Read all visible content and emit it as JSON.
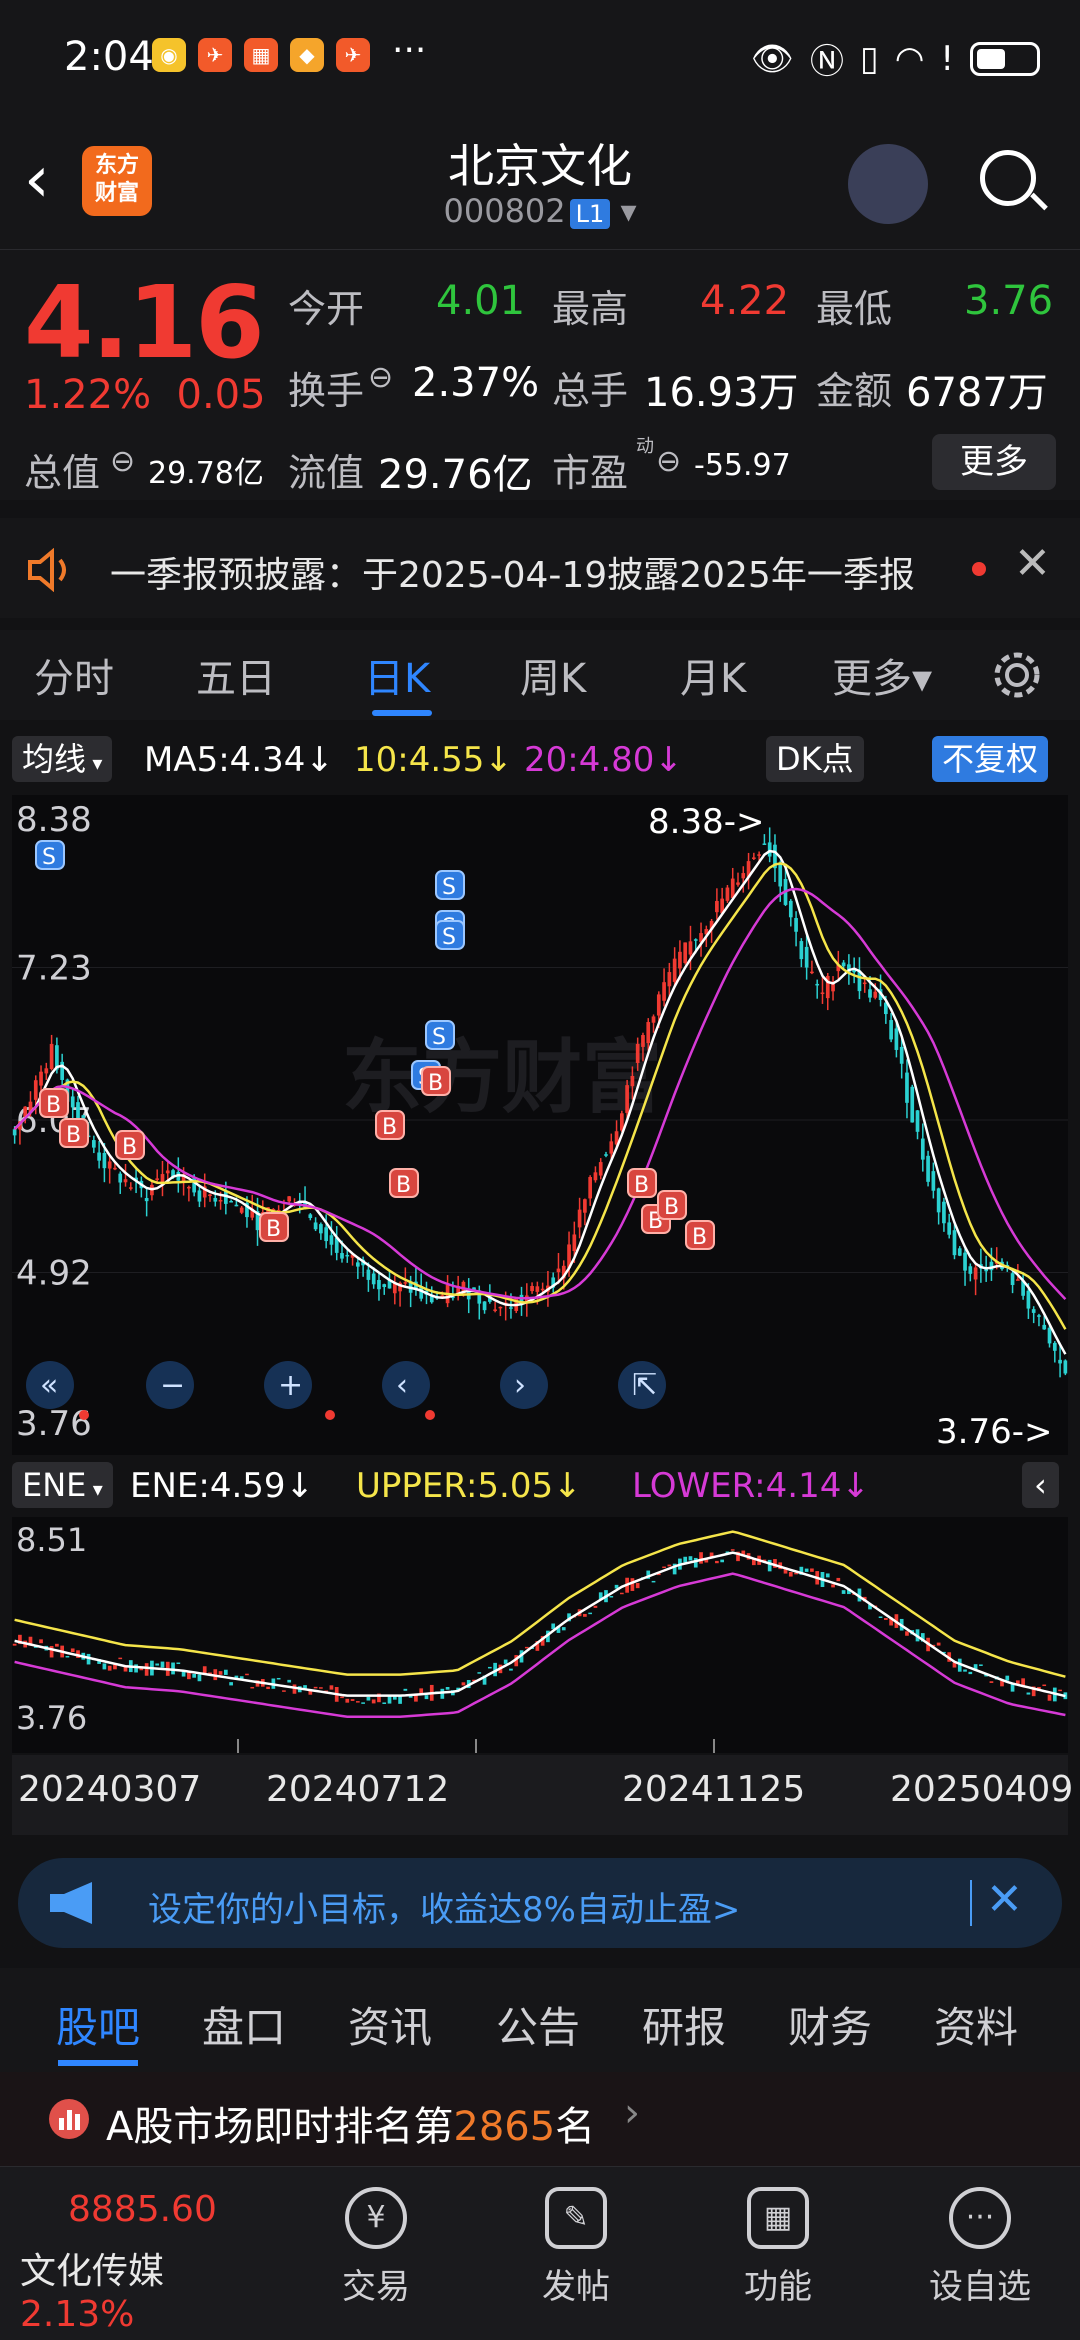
{
  "status": {
    "time": "2:04",
    "more": "···"
  },
  "header": {
    "back": "‹",
    "logo": "东方\n财富",
    "name": "北京文化",
    "code": "000802",
    "level": "L1"
  },
  "quote": {
    "price": "4.16",
    "change_pct": "1.22%",
    "change": "0.05",
    "open_label": "今开",
    "open": "4.01",
    "high_label": "最高",
    "high": "4.22",
    "low_label": "最低",
    "low": "3.76",
    "turnover_label": "换手",
    "turnover": "2.37%",
    "volume_label": "总手",
    "volume": "16.93万",
    "amount_label": "金额",
    "amount": "6787万",
    "mcap_label": "总值",
    "mcap": "29.78亿",
    "float_label": "流值",
    "float": "29.76亿",
    "pe_label": "市盈",
    "pe_sup": "动",
    "pe": "-55.97",
    "more": "更多"
  },
  "notice": {
    "text": "一季报预披露：于2025-04-19披露2025年一季报",
    "close": "✕"
  },
  "tabs": [
    "分时",
    "五日",
    "日K",
    "周K",
    "月K",
    "更多▾"
  ],
  "active_tab": 2,
  "ma": {
    "selector": "均线",
    "ma5": "MA5:4.34↓",
    "ma10": "10:4.55↓",
    "ma20": "20:4.80↓",
    "dk": "DK点",
    "adjust": "不复权"
  },
  "chart_data": [
    {
      "type": "candlestick",
      "title": "",
      "ylim": [
        3.76,
        8.38
      ],
      "yticks": [
        "8.38",
        "7.23",
        "6.07",
        "4.92",
        "3.76"
      ],
      "annotations": [
        "8.38->",
        "3.76->"
      ],
      "close_series": [
        6.0,
        6.3,
        6.6,
        6.2,
        5.9,
        5.7,
        5.6,
        5.5,
        5.7,
        5.6,
        5.5,
        5.5,
        5.4,
        5.3,
        5.4,
        5.5,
        5.3,
        5.1,
        5.0,
        4.9,
        4.8,
        4.8,
        4.7,
        4.75,
        4.8,
        4.7,
        4.65,
        4.7,
        4.8,
        4.9,
        5.3,
        5.7,
        6.0,
        6.5,
        6.9,
        7.2,
        7.4,
        7.6,
        7.8,
        8.0,
        8.2,
        7.8,
        7.3,
        7.0,
        7.3,
        7.1,
        7.0,
        6.6,
        6.0,
        5.5,
        5.1,
        4.9,
        5.0,
        4.9,
        4.7,
        4.4,
        4.16
      ],
      "markers": [
        "S",
        "S",
        "S",
        "S",
        "S",
        "S",
        "B",
        "B",
        "B",
        "B",
        "B",
        "B",
        "B",
        "B",
        "B",
        "B",
        "B",
        "B"
      ]
    },
    {
      "type": "line",
      "title": "",
      "ylim": [
        3.76,
        8.51
      ],
      "yticks": [
        "8.51",
        "3.76"
      ],
      "series": [
        {
          "name": "ENE",
          "values": [
            5.9,
            5.6,
            5.3,
            5.2,
            5.0,
            4.8,
            4.6,
            4.6,
            4.7,
            5.4,
            6.4,
            7.2,
            7.7,
            8.0,
            7.6,
            7.2,
            6.3,
            5.4,
            4.9,
            4.59
          ]
        },
        {
          "name": "UPPER",
          "values": [
            6.4,
            6.1,
            5.8,
            5.7,
            5.5,
            5.3,
            5.1,
            5.1,
            5.2,
            5.9,
            6.9,
            7.7,
            8.2,
            8.5,
            8.1,
            7.7,
            6.8,
            5.9,
            5.4,
            5.05
          ]
        },
        {
          "name": "LOWER",
          "values": [
            5.4,
            5.1,
            4.8,
            4.7,
            4.5,
            4.3,
            4.1,
            4.1,
            4.2,
            4.9,
            5.9,
            6.7,
            7.2,
            7.5,
            7.1,
            6.7,
            5.8,
            4.9,
            4.4,
            4.14
          ]
        }
      ]
    }
  ],
  "ene": {
    "selector": "ENE",
    "ene": "ENE:4.59↓",
    "upper": "UPPER:5.05↓",
    "lower": "LOWER:4.14↓"
  },
  "dates": [
    "20240307",
    "20240712",
    "20241125",
    "20250409"
  ],
  "banner": {
    "text": "设定你的小目标，收益达8%自动止盈>",
    "close": "✕"
  },
  "subtabs": [
    "股吧",
    "盘口",
    "资讯",
    "公告",
    "研报",
    "财务",
    "资料"
  ],
  "rank": {
    "prefix": "A股市场即时排名第",
    "num": "2865",
    "suffix": "名"
  },
  "bottom": {
    "index_value": "8885.60",
    "index_name": "文化传媒",
    "index_pct": "2.13%",
    "items": [
      "交易",
      "发帖",
      "功能",
      "设自选"
    ]
  },
  "colors": {
    "up": "#f03a32",
    "down": "#2fc53d",
    "ma5": "#ffffff",
    "ma10": "#f5e54a",
    "ma20": "#d63ad6",
    "accent": "#2f86ff"
  }
}
